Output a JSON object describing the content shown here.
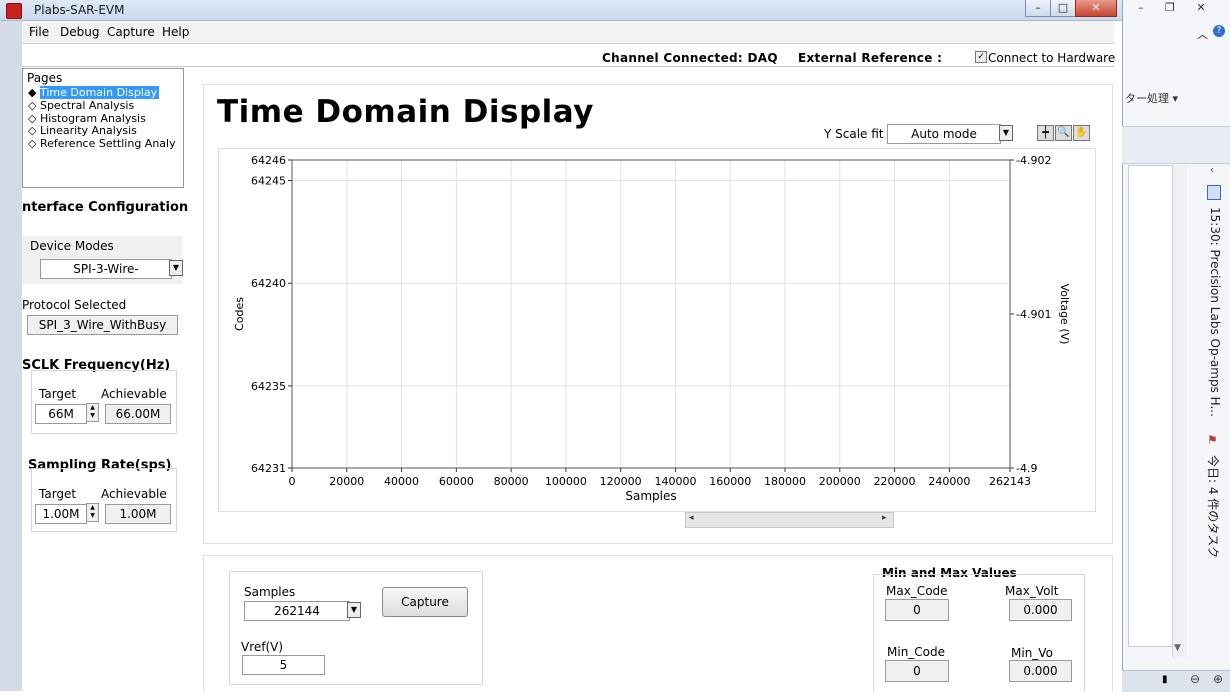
{
  "window": {
    "title": "Plabs-SAR-EVM",
    "minimize_label": "–",
    "maximize_label": "□",
    "close_label": "✕"
  },
  "menu": [
    "File",
    "Debug",
    "Capture",
    "Help"
  ],
  "status": {
    "channel": "Channel Connected: DAQ",
    "reference": "External Reference :",
    "connect_label": "Connect to Hardware",
    "connect_checked": "✓"
  },
  "pages": {
    "header": "Pages",
    "items": [
      "Time Domain Display",
      "Spectral Analysis",
      "Histogram Analysis",
      "Linearity Analysis",
      "Reference Settling Analy"
    ],
    "selected_index": 0
  },
  "interface": {
    "title": "nterface Configuration",
    "device_modes_label": "Device Modes",
    "device_mode": "SPI-3-Wire-",
    "protocol_label": "Protocol Selected",
    "protocol": "SPI_3_Wire_WithBusy"
  },
  "sclk": {
    "title": "SCLK Frequency(Hz)",
    "target_label": "Target",
    "achievable_label": "Achievable",
    "target": "66M",
    "achievable": "66.00M"
  },
  "sampling": {
    "title": "Sampling Rate(sps)",
    "target_label": "Target",
    "achievable_label": "Achievable",
    "target": "1.00M",
    "achievable": "1.00M"
  },
  "main": {
    "title": "Time Domain Display",
    "yscale_label": "Y Scale fit",
    "yscale_value": "Auto mode"
  },
  "chart_data": {
    "type": "line",
    "xlabel": "Samples",
    "ylabel": "Codes",
    "y2label": "Voltage (V)",
    "xlim": [
      0,
      262143
    ],
    "ylim": [
      64231,
      64246
    ],
    "y2lim": [
      -4.9,
      -4.902
    ],
    "x_ticks": [
      "0",
      "20000",
      "40000",
      "60000",
      "80000",
      "100000",
      "120000",
      "140000",
      "160000",
      "180000",
      "200000",
      "220000",
      "240000",
      "262143"
    ],
    "y_ticks": [
      "64246",
      "64245",
      "64240",
      "64235",
      "64231"
    ],
    "y2_ticks": [
      "-4.902",
      "-4.901",
      "-4.9"
    ],
    "grid": true,
    "series": []
  },
  "capture": {
    "samples_label": "Samples",
    "samples": "262144",
    "capture_button": "Capture",
    "vref_label": "Vref(V)",
    "vref": "5"
  },
  "minmax": {
    "title": "Min and Max Values",
    "max_code_label": "Max_Code",
    "max_code": "0",
    "max_volt_label": "Max_Volt",
    "max_volt": "0.000",
    "min_code_label": "Min_Code",
    "min_code": "0",
    "min_volt_label": "Min_Vo",
    "min_volt": "0.000"
  },
  "side_app": {
    "filter_label": "ター処理 ▾",
    "event_text": "15:30: Precision Labs Op-amps H...",
    "task_text": "今日: 4 件のタスク"
  }
}
